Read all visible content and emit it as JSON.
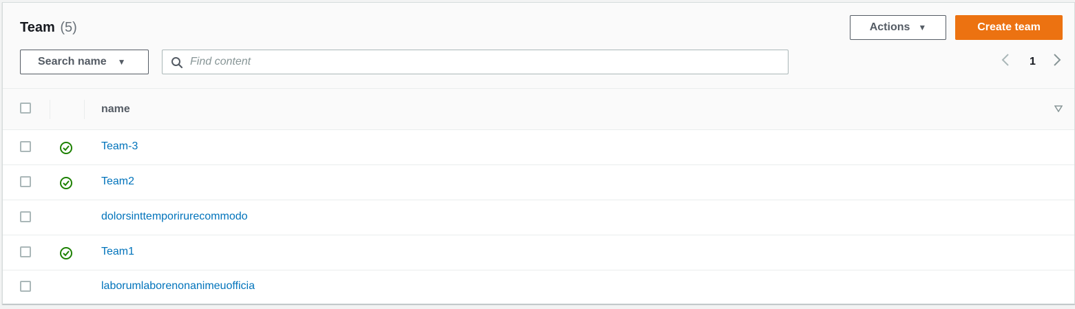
{
  "header": {
    "title": "Team",
    "count": "(5)",
    "actions_label": "Actions",
    "create_label": "Create team"
  },
  "filter": {
    "property_label": "Search name",
    "placeholder": "Find content"
  },
  "pagination": {
    "current_page": "1"
  },
  "table": {
    "columns": [
      "name"
    ],
    "rows": [
      {
        "name": "Team-3",
        "status": "success"
      },
      {
        "name": "Team2",
        "status": "success"
      },
      {
        "name": "dolorsinttemporirurecommodo",
        "status": ""
      },
      {
        "name": "Team1",
        "status": "success"
      },
      {
        "name": "laborumlaborenonanimeuofficia",
        "status": ""
      }
    ]
  },
  "colors": {
    "primary_button": "#ec7211",
    "link": "#0073bb",
    "success": "#1d8102"
  },
  "icons": {
    "status": "status-positive-icon",
    "search": "search-icon",
    "sort": "sort-icon"
  }
}
